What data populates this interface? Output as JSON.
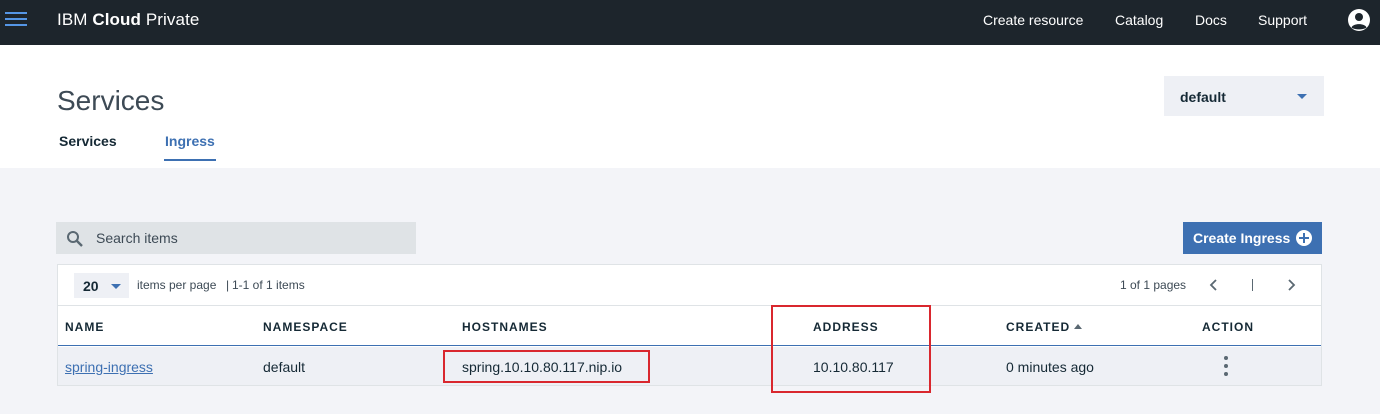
{
  "topbar": {
    "brand_prefix": "IBM ",
    "brand_bold": "Cloud",
    "brand_suffix": " Private",
    "nav": [
      "Create resource",
      "Catalog",
      "Docs",
      "Support"
    ]
  },
  "header": {
    "title": "Services",
    "tabs": [
      {
        "label": "Services",
        "active": false
      },
      {
        "label": "Ingress",
        "active": true
      }
    ],
    "namespace": "default"
  },
  "toolbar": {
    "search_placeholder": "Search items",
    "create_label": "Create Ingress"
  },
  "pager": {
    "per_page": "20",
    "per_page_label": "items per page",
    "range": "1-1 of 1 items",
    "pages": "1 of 1 pages"
  },
  "table": {
    "columns": [
      "NAME",
      "NAMESPACE",
      "HOSTNAMES",
      "ADDRESS",
      "CREATED",
      "ACTION"
    ],
    "sort_column": "CREATED",
    "sort_direction": "ascending",
    "rows": [
      {
        "name": "spring-ingress",
        "namespace": "default",
        "hostnames": "spring.10.10.80.117.nip.io",
        "address": "10.10.80.117",
        "created": "0 minutes ago"
      }
    ]
  },
  "colors": {
    "topbar": "#1d252c",
    "accent": "#3d70b2",
    "highlight": "#d9272e"
  }
}
